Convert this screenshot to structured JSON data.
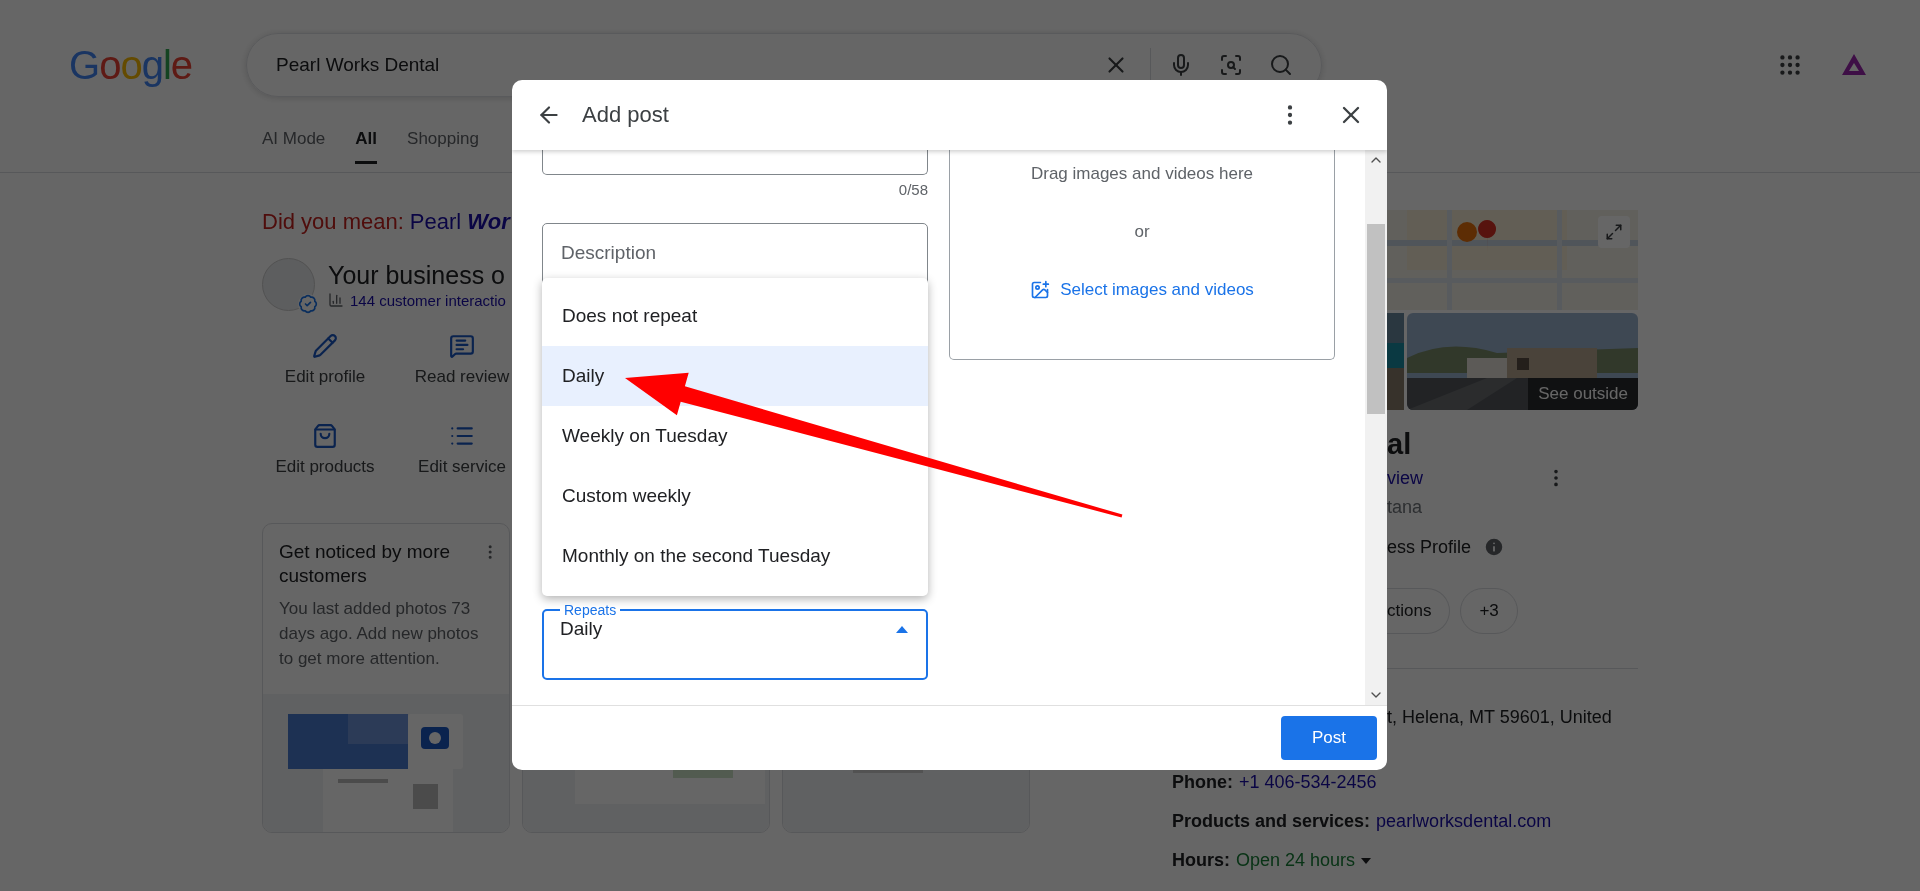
{
  "search_page": {
    "logo": "Google",
    "search_field": {
      "value": "Pearl Works Dental"
    },
    "tabs": [
      {
        "label": "AI Mode",
        "selected": false
      },
      {
        "label": "All",
        "selected": true
      },
      {
        "label": "Shopping",
        "selected": false
      }
    ],
    "did_you_mean": {
      "label": "Did you mean:",
      "suggestion": "Pearl **Wor**"
    },
    "business": {
      "title": "Your business o",
      "interactions": "144 customer interactio",
      "actions": [
        "Edit profile",
        "Read review",
        "Edit products",
        "Edit service"
      ]
    },
    "tip_card": {
      "title": "Get noticed by more customers",
      "body": "You last added photos 73 days ago. Add new photos to get more attention."
    }
  },
  "knowledge_panel": {
    "photo_label": "See outside",
    "heading": "al",
    "review_link": "view",
    "location": "tana",
    "profile_label": "ess Profile",
    "chips": [
      "ctions",
      "+3"
    ],
    "address": "t, Helena, MT 59601, United",
    "phone": {
      "label": "Phone:",
      "value": "+1 406-534-2456"
    },
    "products": {
      "label": "Products and services:",
      "value": "pearlworksdental.com"
    },
    "hours": {
      "label": "Hours:",
      "value": "Open 24 hours"
    }
  },
  "dialog": {
    "title": "Add post",
    "title_counter": "0/58",
    "description": {
      "placeholder": "Description"
    },
    "repeat_options": [
      {
        "label": "Does not repeat",
        "selected": false
      },
      {
        "label": "Daily",
        "selected": true
      },
      {
        "label": "Weekly on Tuesday",
        "selected": false
      },
      {
        "label": "Custom weekly",
        "selected": false
      },
      {
        "label": "Monthly on the second Tuesday",
        "selected": false
      }
    ],
    "repeats": {
      "label": "Repeats",
      "value": "Daily"
    },
    "media": {
      "hint": "Drag images and videos here",
      "or": "or",
      "select_link": "Select images and videos"
    },
    "post_button": "Post"
  }
}
